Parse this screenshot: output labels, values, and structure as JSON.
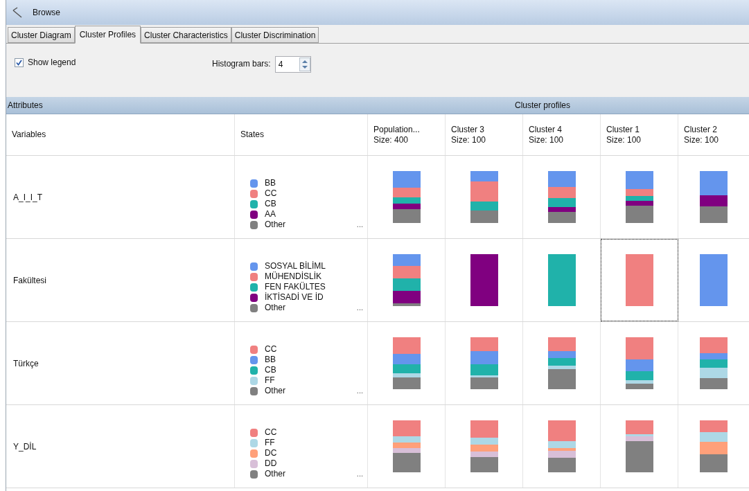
{
  "window": {
    "title": "Browse"
  },
  "tabs": [
    {
      "label": "Cluster Diagram",
      "selected": false
    },
    {
      "label": "Cluster Profiles",
      "selected": true
    },
    {
      "label": "Cluster Characteristics",
      "selected": false
    },
    {
      "label": "Cluster Discrimination",
      "selected": false
    }
  ],
  "toolbar": {
    "show_legend": {
      "label": "Show legend",
      "checked": true
    },
    "histogram_bars": {
      "label": "Histogram bars:",
      "value": "4"
    }
  },
  "grid": {
    "group_headers": [
      "Attributes",
      "Cluster profiles"
    ],
    "columns": [
      {
        "label": "Variables"
      },
      {
        "label": "States"
      },
      {
        "label": "Population...",
        "size": "Size: 400"
      },
      {
        "label": "Cluster 3",
        "size": "Size: 100"
      },
      {
        "label": "Cluster 4",
        "size": "Size: 100"
      },
      {
        "label": "Cluster 1",
        "size": "Size: 100"
      },
      {
        "label": "Cluster 2",
        "size": "Size: 100"
      }
    ],
    "rows": [
      {
        "variable": "A_I_I_T",
        "states": [
          {
            "label": "BB",
            "color": "#6495ed"
          },
          {
            "label": "CC",
            "color": "#f08080"
          },
          {
            "label": "CB",
            "color": "#20b2aa"
          },
          {
            "label": "AA",
            "color": "#800080"
          },
          {
            "label": "Other",
            "color": "#808080"
          }
        ],
        "more": "...",
        "profiles": [
          {
            "selected": false,
            "segments": [
              {
                "color": "#6495ed"
              },
              {
                "color": "#f08080"
              },
              {
                "color": "#20b2aa"
              },
              {
                "color": "#800080"
              },
              {
                "color": "#808080"
              }
            ]
          },
          {
            "selected": false,
            "segments": [
              {
                "color": "#6495ed"
              },
              {
                "color": "#f08080"
              },
              {
                "color": "#20b2aa"
              },
              {
                "color": "#808080"
              }
            ]
          },
          {
            "selected": false,
            "segments": [
              {
                "color": "#6495ed"
              },
              {
                "color": "#f08080"
              },
              {
                "color": "#20b2aa"
              },
              {
                "color": "#800080"
              },
              {
                "color": "#808080"
              }
            ]
          },
          {
            "selected": false,
            "segments": [
              {
                "color": "#6495ed"
              },
              {
                "color": "#f08080"
              },
              {
                "color": "#20b2aa"
              },
              {
                "color": "#800080"
              },
              {
                "color": "#808080"
              }
            ]
          },
          {
            "selected": false,
            "segments": [
              {
                "color": "#6495ed"
              },
              {
                "color": "#800080"
              },
              {
                "color": "#808080"
              }
            ]
          }
        ]
      },
      {
        "variable": "Fakültesi",
        "states": [
          {
            "label": "SOSYAL BİLİML",
            "color": "#6495ed"
          },
          {
            "label": "MÜHENDİSLİK",
            "color": "#f08080"
          },
          {
            "label": "FEN FAKÜLTES",
            "color": "#20b2aa"
          },
          {
            "label": "İKTİSADİ VE İD",
            "color": "#800080"
          },
          {
            "label": "Other",
            "color": "#808080"
          }
        ],
        "more": "...",
        "profiles": [
          {
            "selected": false,
            "segments": [
              {
                "color": "#6495ed"
              },
              {
                "color": "#f08080"
              },
              {
                "color": "#20b2aa"
              },
              {
                "color": "#800080"
              },
              {
                "color": "#808080"
              }
            ]
          },
          {
            "selected": false,
            "segments": [
              {
                "color": "#800080"
              }
            ]
          },
          {
            "selected": false,
            "segments": [
              {
                "color": "#20b2aa"
              }
            ]
          },
          {
            "selected": true,
            "segments": [
              {
                "color": "#f08080"
              }
            ]
          },
          {
            "selected": false,
            "segments": [
              {
                "color": "#6495ed"
              }
            ]
          }
        ]
      },
      {
        "variable": "Türkçe",
        "states": [
          {
            "label": "CC",
            "color": "#f08080"
          },
          {
            "label": "BB",
            "color": "#6495ed"
          },
          {
            "label": "CB",
            "color": "#20b2aa"
          },
          {
            "label": "FF",
            "color": "#add8e6"
          },
          {
            "label": "Other",
            "color": "#808080"
          }
        ],
        "more": "...",
        "profiles": [
          {
            "selected": false,
            "segments": [
              {
                "color": "#f08080"
              },
              {
                "color": "#6495ed"
              },
              {
                "color": "#20b2aa"
              },
              {
                "color": "#add8e6"
              },
              {
                "color": "#808080"
              }
            ]
          },
          {
            "selected": false,
            "segments": [
              {
                "color": "#f08080"
              },
              {
                "color": "#6495ed"
              },
              {
                "color": "#20b2aa"
              },
              {
                "color": "#add8e6"
              },
              {
                "color": "#808080"
              }
            ]
          },
          {
            "selected": false,
            "segments": [
              {
                "color": "#f08080"
              },
              {
                "color": "#6495ed"
              },
              {
                "color": "#20b2aa"
              },
              {
                "color": "#add8e6"
              },
              {
                "color": "#808080"
              }
            ]
          },
          {
            "selected": false,
            "segments": [
              {
                "color": "#f08080"
              },
              {
                "color": "#6495ed"
              },
              {
                "color": "#20b2aa"
              },
              {
                "color": "#add8e6"
              },
              {
                "color": "#808080"
              }
            ]
          },
          {
            "selected": false,
            "segments": [
              {
                "color": "#f08080"
              },
              {
                "color": "#6495ed"
              },
              {
                "color": "#20b2aa"
              },
              {
                "color": "#add8e6"
              },
              {
                "color": "#808080"
              }
            ]
          }
        ]
      },
      {
        "variable": "Y_DİL",
        "states": [
          {
            "label": "CC",
            "color": "#f08080"
          },
          {
            "label": "FF",
            "color": "#add8e6"
          },
          {
            "label": "DC",
            "color": "#ffa07a"
          },
          {
            "label": "DD",
            "color": "#d8bfd8"
          },
          {
            "label": "Other",
            "color": "#808080"
          }
        ],
        "more": "...",
        "profiles": [
          {
            "selected": false,
            "segments": [
              {
                "color": "#f08080"
              },
              {
                "color": "#add8e6"
              },
              {
                "color": "#ffa07a"
              },
              {
                "color": "#d8bfd8"
              },
              {
                "color": "#808080"
              }
            ]
          },
          {
            "selected": false,
            "segments": [
              {
                "color": "#f08080"
              },
              {
                "color": "#add8e6"
              },
              {
                "color": "#ffa07a"
              },
              {
                "color": "#d8bfd8"
              },
              {
                "color": "#808080"
              }
            ]
          },
          {
            "selected": false,
            "segments": [
              {
                "color": "#f08080"
              },
              {
                "color": "#add8e6"
              },
              {
                "color": "#ffa07a"
              },
              {
                "color": "#d8bfd8"
              },
              {
                "color": "#808080"
              }
            ]
          },
          {
            "selected": false,
            "segments": [
              {
                "color": "#f08080"
              },
              {
                "color": "#add8e6"
              },
              {
                "color": "#d8bfd8"
              },
              {
                "color": "#808080"
              }
            ]
          },
          {
            "selected": false,
            "segments": [
              {
                "color": "#f08080"
              },
              {
                "color": "#add8e6"
              },
              {
                "color": "#ffa07a"
              },
              {
                "color": "#808080"
              }
            ]
          }
        ]
      }
    ]
  }
}
